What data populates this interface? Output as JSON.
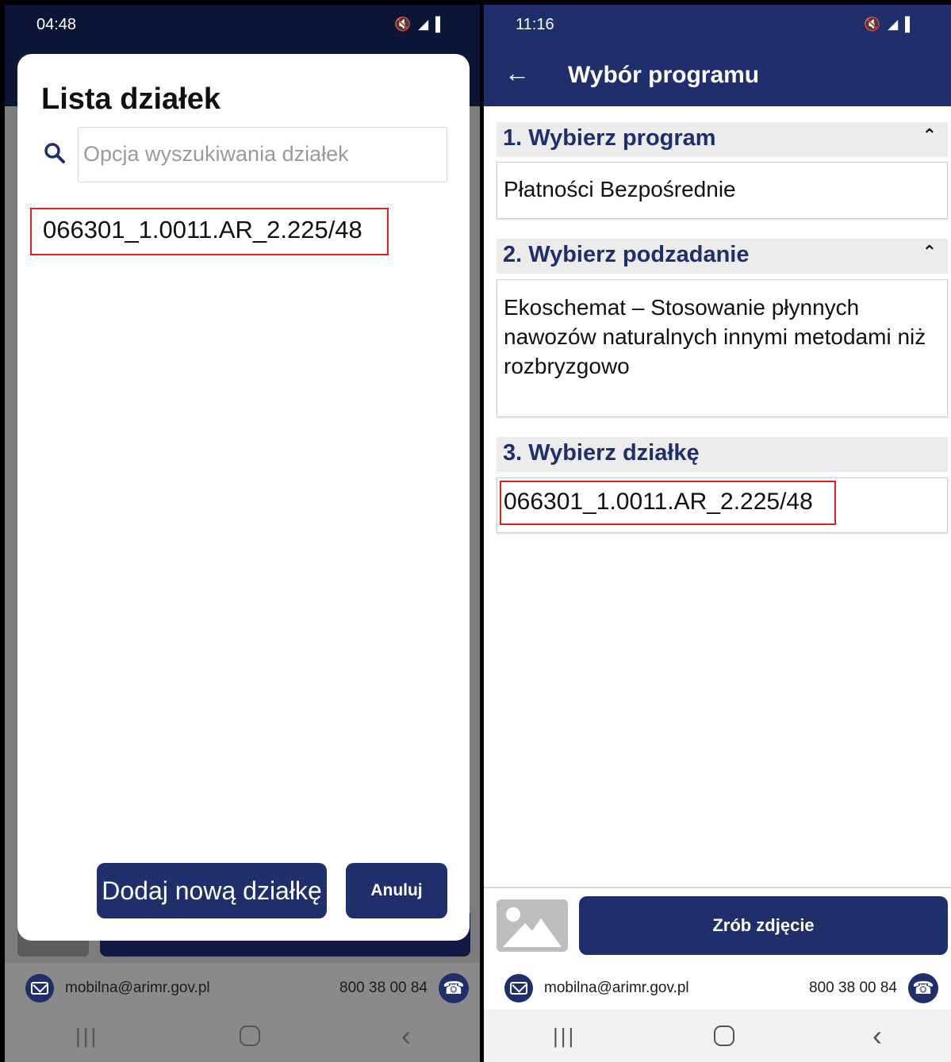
{
  "left": {
    "status": {
      "time": "04:48"
    },
    "dialog": {
      "title": "Lista działek",
      "search_placeholder": "Opcja wyszukiwania działek",
      "plots": [
        "066301_1.0011.AR_2.225/48"
      ],
      "add_button": "Dodaj nową działkę",
      "cancel_button": "Anuluj"
    },
    "contact": {
      "email": "mobilna@arimr.gov.pl",
      "phone": "800 38 00 84"
    }
  },
  "right": {
    "status": {
      "time": "11:16"
    },
    "appbar": {
      "title": "Wybór programu"
    },
    "section1": {
      "header": "1. Wybierz program",
      "value": "Płatności Bezpośrednie"
    },
    "section2": {
      "header": "2. Wybierz podzadanie",
      "value": "Ekoschemat – Stosowanie płynnych nawozów naturalnych innymi metodami niż rozbryzgowo"
    },
    "section3": {
      "header": "3. Wybierz działkę",
      "value": "066301_1.0011.AR_2.225/48"
    },
    "photo_button": "Zrób zdjęcie",
    "contact": {
      "email": "mobilna@arimr.gov.pl",
      "phone": "800 38 00 84"
    }
  },
  "colors": {
    "brand": "#1e2f6c",
    "highlight": "#e02020"
  }
}
